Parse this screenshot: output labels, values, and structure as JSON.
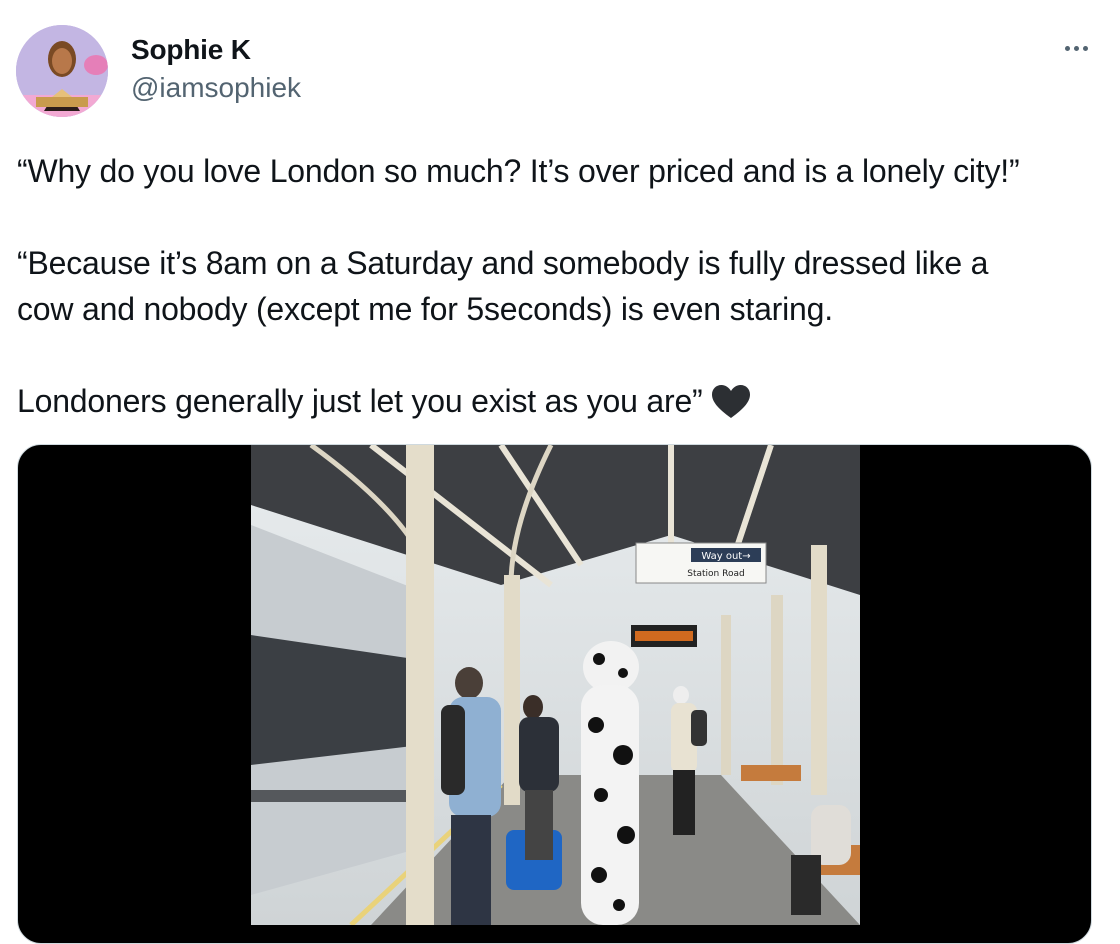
{
  "author": {
    "name": "Sophie K",
    "handle": "@iamsophiek",
    "avatar_icon": "profile-photo"
  },
  "menu": {
    "icon": "more-horizontal-icon"
  },
  "tweet": {
    "line1": "“Why do you love London so much? It’s over priced and is a lonely city!”",
    "line2": "“Because it’s 8am on a Saturday and somebody is fully dressed like a\ncow and nobody (except me for 5seconds) is even staring.",
    "line3": "Londoners generally just let you exist as you are”",
    "emoji": "black-heart-icon"
  },
  "media": {
    "sign_way_out": "Way out→",
    "sign_station": "Station Road",
    "description_icon": "station-platform-photo"
  },
  "colors": {
    "handle": "#536471",
    "text": "#0f1419"
  }
}
